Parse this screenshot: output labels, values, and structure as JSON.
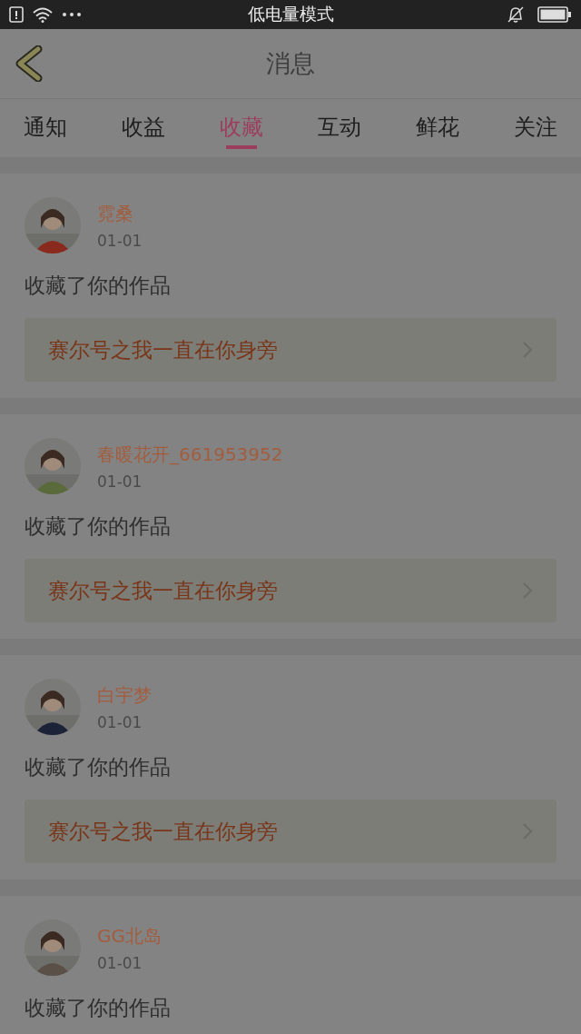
{
  "status_bar": {
    "title": "低电量模式"
  },
  "header": {
    "title": "消息"
  },
  "tabs": [
    {
      "label": "通知",
      "selected": false
    },
    {
      "label": "收益",
      "selected": false
    },
    {
      "label": "收藏",
      "selected": true
    },
    {
      "label": "互动",
      "selected": false
    },
    {
      "label": "鲜花",
      "selected": false
    },
    {
      "label": "关注",
      "selected": false
    }
  ],
  "messages": [
    {
      "name": "霓桑",
      "date": "01-01",
      "text": "收藏了你的作品",
      "link": "赛尔号之我一直在你身旁"
    },
    {
      "name": "春暖花开_661953952",
      "date": "01-01",
      "text": "收藏了你的作品",
      "link": "赛尔号之我一直在你身旁"
    },
    {
      "name": "白宇梦",
      "date": "01-01",
      "text": "收藏了你的作品",
      "link": "赛尔号之我一直在你身旁"
    },
    {
      "name": "GG北岛",
      "date": "01-01",
      "text": "收藏了你的作品"
    }
  ]
}
